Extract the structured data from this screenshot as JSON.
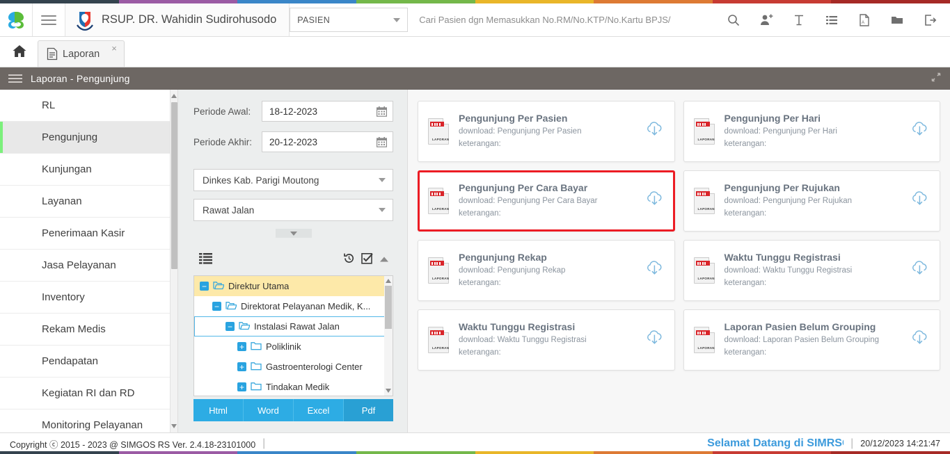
{
  "theme": {
    "accent_green": "#7cf07c",
    "accent_blue": "#2dace4",
    "selected_red": "#ec1c24",
    "breadcrumb_bg": "#6d6763",
    "welcome_blue": "#3d9bdc"
  },
  "top_strip": [
    "#34434e",
    "#9b5ba4",
    "#3a86c8",
    "#74b84a",
    "#e9b629",
    "#dd7a34",
    "#c73b33",
    "#a62a26"
  ],
  "header": {
    "logo_icon": "simgos-swirl-logo",
    "menu_icon": "hamburger-icon",
    "hospital_icon": "hospital-shield-logo",
    "brand": "RSUP. DR. Wahidin Sudirohusodo",
    "module_select": {
      "value": "PASIEN",
      "caret_icon": "chevron-down-icon"
    },
    "search": {
      "value": "",
      "placeholder": "Cari Pasien dgn Memasukkan No.RM/No.KTP/No.Kartu BPJS/"
    },
    "icons": [
      {
        "name": "search-icon",
        "glyph": "⌕"
      },
      {
        "name": "add-user-icon",
        "glyph": "person-plus"
      },
      {
        "name": "text-tool-icon",
        "glyph": "text-cursor"
      },
      {
        "name": "list-icon",
        "glyph": "list"
      },
      {
        "name": "pdf-icon",
        "glyph": "pdf-file"
      },
      {
        "name": "folder-icon",
        "glyph": "folder"
      },
      {
        "name": "logout-icon",
        "glyph": "exit"
      }
    ]
  },
  "tabbar": {
    "home_icon": "home-icon",
    "tabs": [
      {
        "label": "Laporan",
        "icon": "document-icon",
        "close": "×",
        "active": true
      }
    ]
  },
  "breadcrumb": {
    "menu_icon": "hamburger-icon",
    "title": "Laporan - Pengunjung",
    "expand_icon": "expand-arrows-icon"
  },
  "sidebar": {
    "items": [
      {
        "label": "RL",
        "active": false
      },
      {
        "label": "Pengunjung",
        "active": true
      },
      {
        "label": "Kunjungan",
        "active": false
      },
      {
        "label": "Layanan",
        "active": false
      },
      {
        "label": "Penerimaan Kasir",
        "active": false
      },
      {
        "label": "Jasa Pelayanan",
        "active": false
      },
      {
        "label": "Inventory",
        "active": false
      },
      {
        "label": "Rekam Medis",
        "active": false
      },
      {
        "label": "Pendapatan",
        "active": false
      },
      {
        "label": "Kegiatan RI dan RD",
        "active": false
      },
      {
        "label": "Monitoring Pelayanan",
        "active": false
      }
    ]
  },
  "filters": {
    "periode_awal": {
      "label": "Periode Awal:",
      "value": "18-12-2023",
      "icon": "calendar-icon"
    },
    "periode_akhir": {
      "label": "Periode Akhir:",
      "value": "20-12-2023",
      "icon": "calendar-icon"
    },
    "unit_select": {
      "value": "Dinkes Kab. Parigi Moutong",
      "caret_icon": "chevron-down-icon"
    },
    "layanan_select": {
      "value": "Rawat Jalan",
      "caret_icon": "chevron-down-icon"
    },
    "collapse_icon": "chevron-down-icon",
    "tree_tools": {
      "list_icon": "list-view-icon",
      "refresh_icon": "history-refresh-icon",
      "checkall_icon": "check-square-icon",
      "collapse_icon": "chevron-up-icon"
    },
    "tree": [
      {
        "label": "Direktur Utama",
        "indent": 0,
        "toggle": "minus",
        "folder": "folder-open-icon",
        "state": "highlight"
      },
      {
        "label": "Direktorat Pelayanan Medik, K...",
        "indent": 1,
        "toggle": "minus",
        "folder": "folder-open-icon",
        "state": "normal"
      },
      {
        "label": "Instalasi Rawat Jalan",
        "indent": 2,
        "toggle": "minus",
        "folder": "folder-open-icon",
        "state": "selected"
      },
      {
        "label": "Poliklinik",
        "indent": 3,
        "toggle": "plus",
        "folder": "folder-icon",
        "state": "normal"
      },
      {
        "label": "Gastroenterologi Center",
        "indent": 3,
        "toggle": "plus",
        "folder": "folder-icon",
        "state": "normal"
      },
      {
        "label": "Tindakan Medik",
        "indent": 3,
        "toggle": "plus",
        "folder": "folder-icon",
        "state": "normal"
      }
    ],
    "formats": [
      {
        "label": "Html",
        "active": false
      },
      {
        "label": "Word",
        "active": false
      },
      {
        "label": "Excel",
        "active": false
      },
      {
        "label": "Pdf",
        "active": true
      }
    ]
  },
  "reports": {
    "download_prefix": "download:",
    "keterangan_label": "keterangan:",
    "download_icon": "cloud-download-icon",
    "file_icon": "laporan-document-icon",
    "cards": [
      {
        "title": "Pengunjung Per Pasien",
        "download": "download: Pengunjung Per Pasien",
        "keterangan": "keterangan:",
        "selected": false
      },
      {
        "title": "Pengunjung Per Hari",
        "download": "download: Pengunjung Per Hari",
        "keterangan": "keterangan:",
        "selected": false
      },
      {
        "title": "Pengunjung Per Cara Bayar",
        "download": "download: Pengunjung Per Cara Bayar",
        "keterangan": "keterangan:",
        "selected": true
      },
      {
        "title": "Pengunjung Per Rujukan",
        "download": "download: Pengunjung Per Rujukan",
        "keterangan": "keterangan:",
        "selected": false
      },
      {
        "title": "Pengunjung Rekap",
        "download": "download: Pengunjung Rekap",
        "keterangan": "keterangan:",
        "selected": false
      },
      {
        "title": "Waktu Tunggu Registrasi",
        "download": "download: Waktu Tunggu Registrasi",
        "keterangan": "keterangan:",
        "selected": false
      },
      {
        "title": "Waktu Tunggu Registrasi",
        "download": "download: Waktu Tunggu Registrasi",
        "keterangan": "keterangan:",
        "selected": false
      },
      {
        "title": "Laporan Pasien Belum Grouping",
        "download": "download: Laporan Pasien Belum Grouping",
        "keterangan": "keterangan:",
        "selected": false
      }
    ]
  },
  "footer": {
    "copyright": "Copyright ⓒ 2015 - 2023 @ SIMGOS RS Ver. 2.4.18-23101000",
    "welcome": "Selamat Datang di SIMRSGOS",
    "timestamp": "20/12/2023 14:21:47"
  }
}
